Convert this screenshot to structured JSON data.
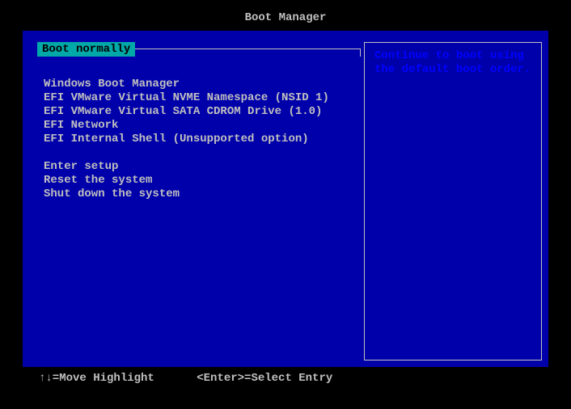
{
  "title": "Boot Manager",
  "selected_label": "Boot normally",
  "boot_options": [
    "Windows Boot Manager",
    "EFI VMware Virtual NVME Namespace (NSID 1)",
    "EFI VMware Virtual SATA CDROM Drive (1.0)",
    "EFI Network",
    "EFI Internal Shell (Unsupported option)"
  ],
  "system_options": [
    "Enter setup",
    "Reset the system",
    "Shut down the system"
  ],
  "description": {
    "line1": "Continue to boot using",
    "line2": "the default boot order."
  },
  "footer": {
    "move": "↑↓=Move Highlight",
    "select": "<Enter>=Select Entry"
  },
  "colors": {
    "bg_outer": "#000000",
    "bg_inner": "#0000aa",
    "text": "#c0c0c0",
    "highlight_bg": "#00a8a8",
    "desc_text": "#0000ff"
  }
}
